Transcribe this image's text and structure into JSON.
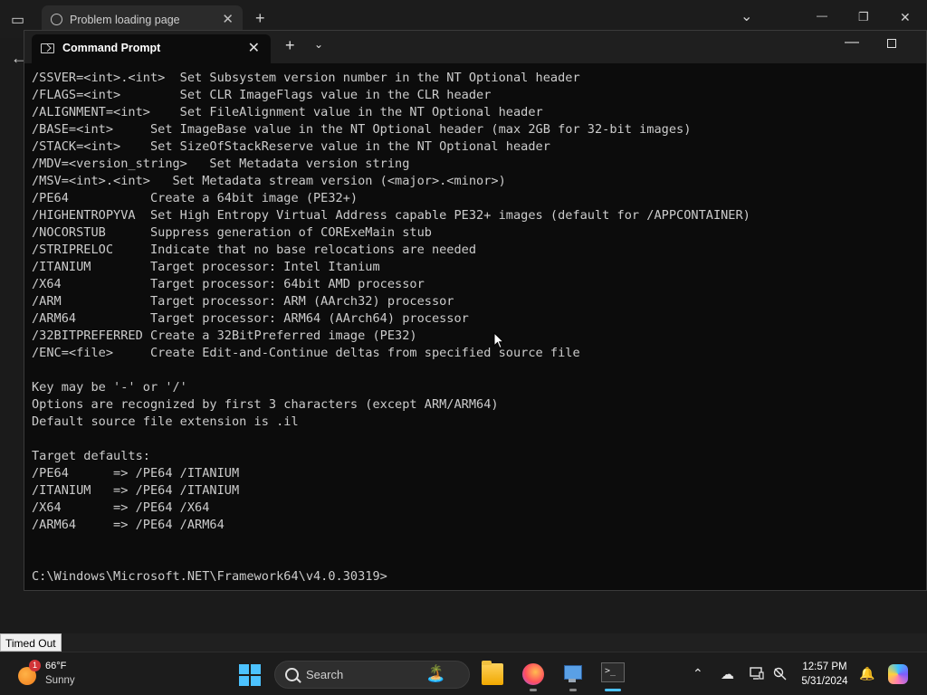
{
  "browser": {
    "tab_title": "Problem loading page",
    "tab_close": "✕",
    "new_tab": "+",
    "tab_list": "⌄",
    "minimize": "—",
    "restore": "❐",
    "close": "✕",
    "back": "←",
    "status_tooltip": "Timed Out"
  },
  "terminal": {
    "tab_title": "Command Prompt",
    "tab_close": "✕",
    "new_tab": "+",
    "dropdown": "⌄",
    "minimize": "—",
    "output_lines": [
      "/SSVER=<int>.<int>  Set Subsystem version number in the NT Optional header",
      "/FLAGS=<int>        Set CLR ImageFlags value in the CLR header",
      "/ALIGNMENT=<int>    Set FileAlignment value in the NT Optional header",
      "/BASE=<int>     Set ImageBase value in the NT Optional header (max 2GB for 32-bit images)",
      "/STACK=<int>    Set SizeOfStackReserve value in the NT Optional header",
      "/MDV=<version_string>   Set Metadata version string",
      "/MSV=<int>.<int>   Set Metadata stream version (<major>.<minor>)",
      "/PE64           Create a 64bit image (PE32+)",
      "/HIGHENTROPYVA  Set High Entropy Virtual Address capable PE32+ images (default for /APPCONTAINER)",
      "/NOCORSTUB      Suppress generation of CORExeMain stub",
      "/STRIPRELOC     Indicate that no base relocations are needed",
      "/ITANIUM        Target processor: Intel Itanium",
      "/X64            Target processor: 64bit AMD processor",
      "/ARM            Target processor: ARM (AArch32) processor",
      "/ARM64          Target processor: ARM64 (AArch64) processor",
      "/32BITPREFERRED Create a 32BitPreferred image (PE32)",
      "/ENC=<file>     Create Edit-and-Continue deltas from specified source file",
      "",
      "Key may be '-' or '/'",
      "Options are recognized by first 3 characters (except ARM/ARM64)",
      "Default source file extension is .il",
      "",
      "Target defaults:",
      "/PE64      => /PE64 /ITANIUM",
      "/ITANIUM   => /PE64 /ITANIUM",
      "/X64       => /PE64 /X64",
      "/ARM64     => /PE64 /ARM64",
      "",
      "",
      "C:\\Windows\\Microsoft.NET\\Framework64\\v4.0.30319>"
    ]
  },
  "taskbar": {
    "weather": {
      "temp": "66°F",
      "desc": "Sunny",
      "badge": "1"
    },
    "search_placeholder": "Search",
    "search_decor": "🏝️",
    "terminal_glyph": ">_",
    "tray": {
      "chevron": "⌃",
      "onedrive": "☁",
      "notification": "🔔"
    },
    "clock": {
      "time": "12:57 PM",
      "date": "5/31/2024"
    }
  },
  "colors": {
    "accent": "#4cc2ff",
    "terminal_bg": "#0c0c0c",
    "terminal_text": "#cccccc"
  }
}
